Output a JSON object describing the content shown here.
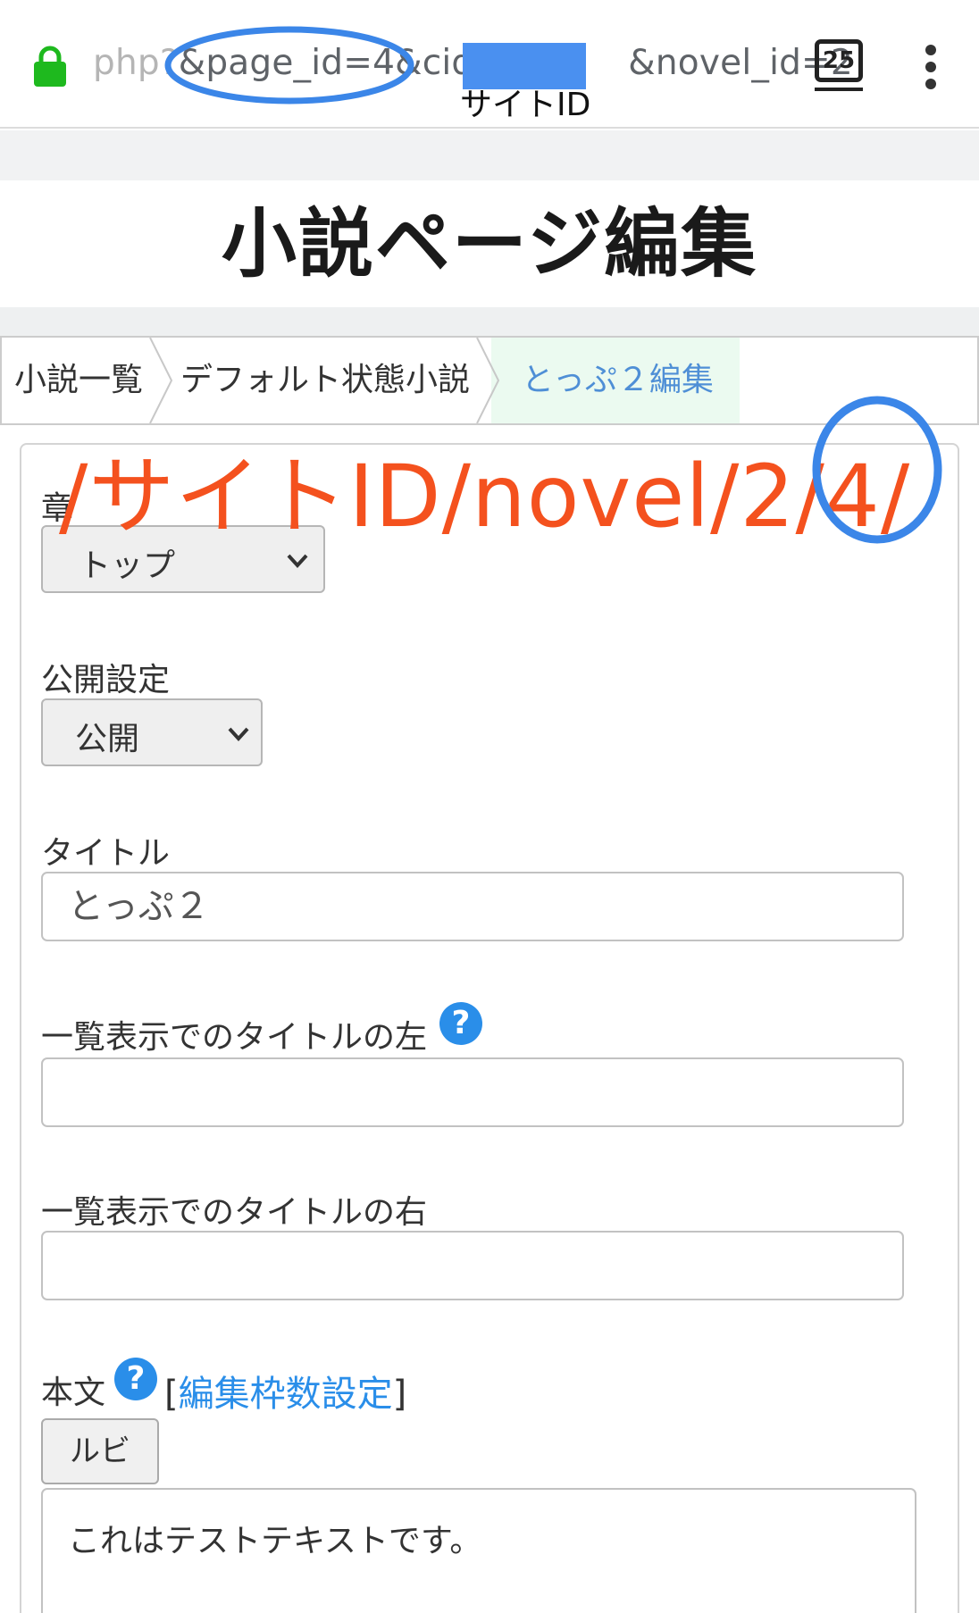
{
  "browser": {
    "url_prefix": "php?",
    "url_part1": "&page_id=4&cid=",
    "url_part2": "&novel_id=2",
    "redaction_note": "サイトID",
    "tab_count": "25"
  },
  "page": {
    "title": "小説ページ編集"
  },
  "breadcrumb": {
    "items": [
      "小説一覧",
      "デフォルト状態小説",
      "とっぷ２編集"
    ]
  },
  "form": {
    "chapter_label": "章",
    "chapter_value": "トップ",
    "visibility_label": "公開設定",
    "visibility_value": "公開",
    "title_label": "タイトル",
    "title_value": "とっぷ２",
    "left_label": "一覧表示でのタイトルの左",
    "left_value": "",
    "right_label": "一覧表示でのタイトルの右",
    "right_value": "",
    "body_label": "本文",
    "help_glyph": "?",
    "frame_link_open": "[",
    "frame_link_text": "編集枠数設定",
    "frame_link_close": "]",
    "ruby_button": "ルビ",
    "body_value": "これはテストテキストです。"
  },
  "annotation": {
    "path_text": "/サイトID/novel/2/4/"
  },
  "colors": {
    "annotation_red": "#f4511e",
    "annotation_blue": "#3b86e8",
    "link_blue": "#2a8ee9",
    "lock_green": "#1eb91e"
  }
}
